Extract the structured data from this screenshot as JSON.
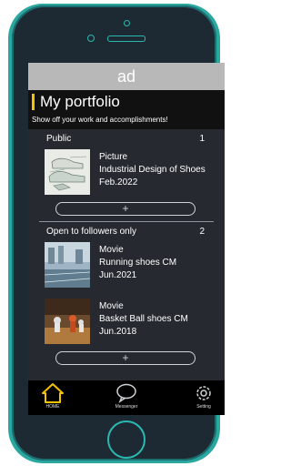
{
  "ad_banner": "ad",
  "page": {
    "title": "My portfolio",
    "subtitle": "Show off your work and accomplishments!"
  },
  "sections": [
    {
      "label": "Public",
      "count": "1",
      "items": [
        {
          "type": "Picture",
          "name": "Industrial Design of Shoes",
          "date": "Feb.2022",
          "thumb": "shoe-sketches-image"
        }
      ],
      "add_label": "+"
    },
    {
      "label": "Open to followers only",
      "count": "2",
      "items": [
        {
          "type": "Movie",
          "name": "Running shoes CM",
          "date": "Jun.2021",
          "thumb": "running-track-image"
        },
        {
          "type": "Movie",
          "name": "Basket Ball shoes CM",
          "date": "Jun.2018",
          "thumb": "basketball-court-image"
        }
      ],
      "add_label": "+"
    }
  ],
  "tabbar": {
    "home": "HOME",
    "messenger": "Messenger",
    "setting": "Setting"
  },
  "colors": {
    "accent": "#f5c400",
    "phone_frame": "#2aa8a0",
    "screen_bg": "#262a30"
  }
}
